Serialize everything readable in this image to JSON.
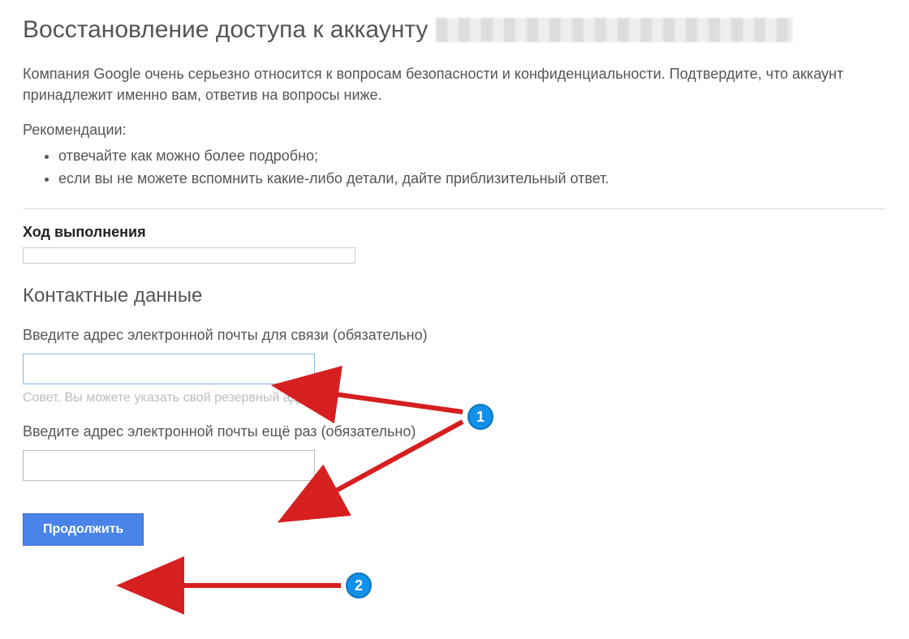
{
  "page": {
    "title": "Восстановление доступа к аккаунту",
    "intro": "Компания Google очень серьезно относится к вопросам безопасности и конфиденциальности. Подтвердите, что аккаунт принадлежит именно вам, ответив на вопросы ниже.",
    "recommendations_label": "Рекомендации:",
    "recommendations": [
      "отвечайте как можно более подробно;",
      "если вы не можете вспомнить какие-либо детали, дайте приблизительный ответ."
    ],
    "progress_label": "Ход выполнения",
    "contact_heading": "Контактные данные",
    "email_label": "Введите адрес электронной почты для связи (обязательно)",
    "email_value": "",
    "email_hint": "Совет. Вы можете указать свой резервный адрес.",
    "email_confirm_label": "Введите адрес электронной почты ещё раз (обязательно)",
    "email_confirm_value": "",
    "continue_label": "Продолжить"
  },
  "annotations": {
    "badge1": "1",
    "badge2": "2"
  }
}
